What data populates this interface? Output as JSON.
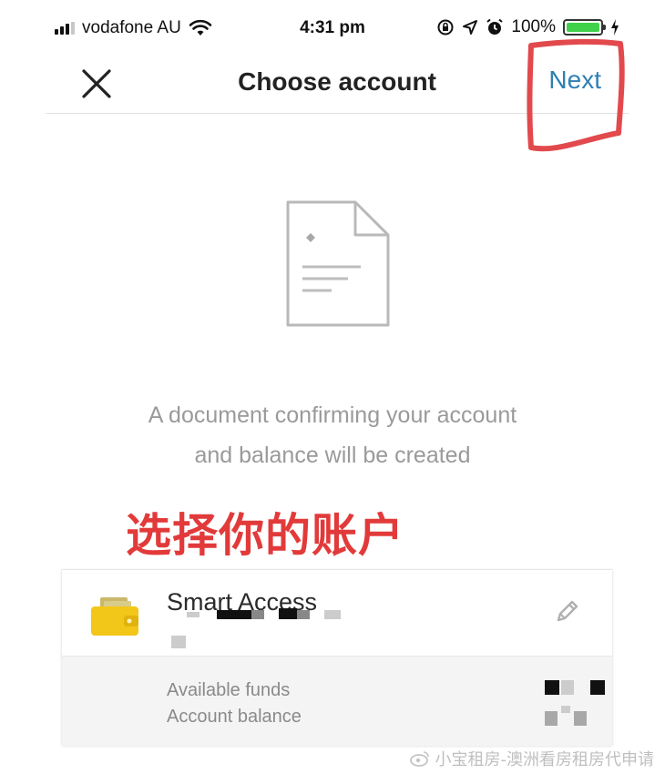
{
  "status_bar": {
    "carrier": "vodafone AU",
    "time": "4:31 pm",
    "battery_percent": "100%",
    "battery_level": 1.0,
    "icons": [
      "signal-icon",
      "wifi-icon",
      "screen-lock-icon",
      "location-icon",
      "alarm-icon",
      "battery-icon",
      "charging-icon"
    ]
  },
  "nav": {
    "close_icon": "close-icon",
    "title": "Choose account",
    "next_label": "Next",
    "next_color": "#2f7fb3"
  },
  "main": {
    "illustration_icon": "document-icon",
    "description_line1": "A document confirming your account",
    "description_line2": "and balance will be created",
    "annotation": "选择你的账户",
    "annotation_color": "#e23a3a"
  },
  "account": {
    "icon": "wallet-icon",
    "name": "Smart Access",
    "edit_icon": "pencil-icon",
    "funds_label": "Available funds",
    "balance_label": "Account balance"
  },
  "watermark": {
    "text": "小宝租房-澳洲看房租房代申请",
    "icon": "weibo-icon"
  }
}
